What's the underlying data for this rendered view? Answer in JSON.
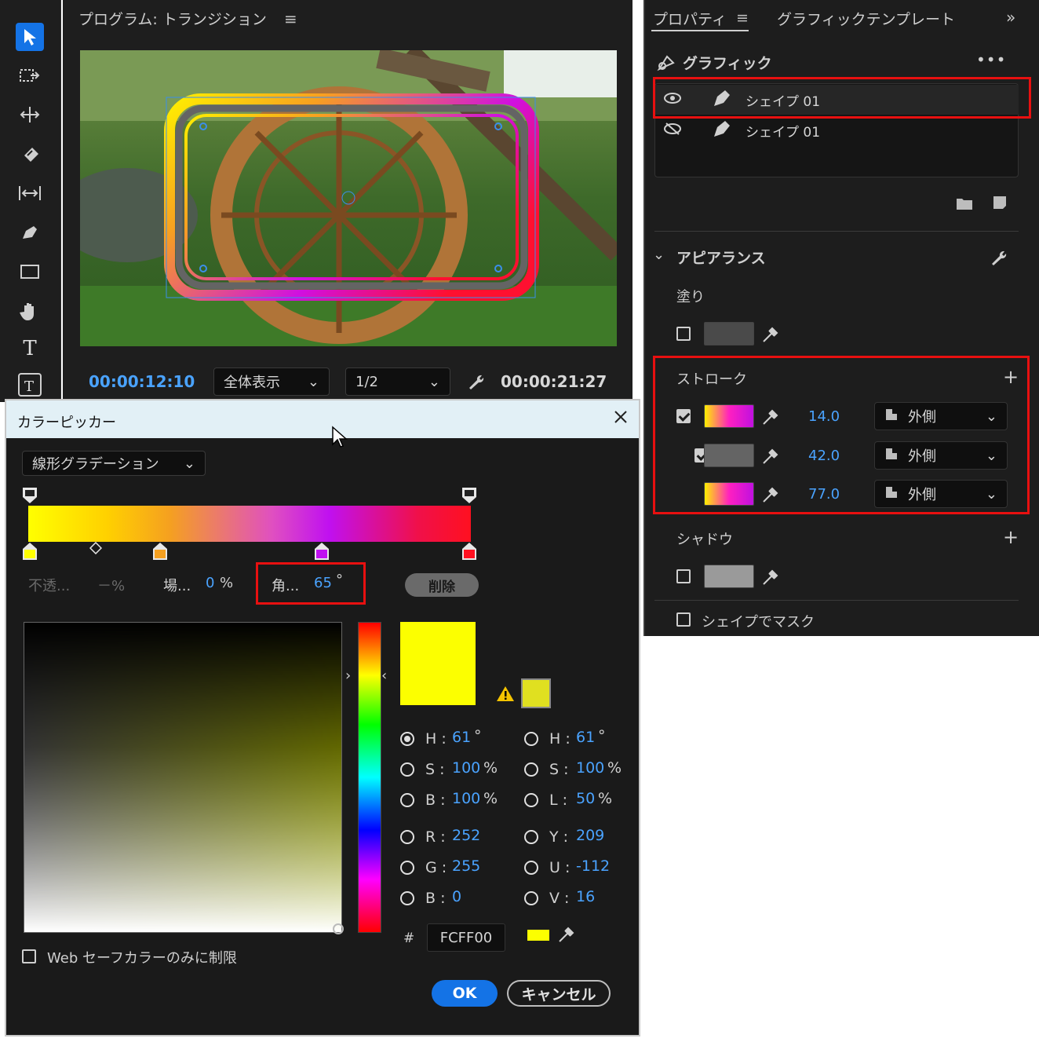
{
  "monitor": {
    "title": "プログラム: トランジション",
    "current_time": "00:00:12:10",
    "fit_select": "全体表示",
    "resolution_select": "1/2",
    "duration": "00:00:21:27"
  },
  "properties": {
    "tab_properties": "プロパティ",
    "tab_graphic_template": "グラフィックテンプレート",
    "graphic_header": "グラフィック",
    "layers": [
      {
        "name": "シェイプ 01",
        "visible": true
      },
      {
        "name": "シェイプ 01",
        "visible": false
      }
    ],
    "appearance": "アピアランス",
    "fill_label": "塗り",
    "stroke_label": "ストローク",
    "strokes": [
      {
        "width": "14.0",
        "position": "外側",
        "type": "gradient"
      },
      {
        "width": "42.0",
        "position": "外側",
        "type": "solid"
      },
      {
        "width": "77.0",
        "position": "外側",
        "type": "gradient"
      }
    ],
    "shadow_label": "シャドウ",
    "mask_label": "シェイプでマスク"
  },
  "color_picker": {
    "title": "カラーピッカー",
    "mode": "線形グラデーション",
    "opacity_label": "不透...",
    "opacity_value": "－%",
    "location_label": "場...",
    "location_value": "0",
    "location_unit": "%",
    "angle_label": "角...",
    "angle_value": "65",
    "angle_unit": "°",
    "delete_button": "削除",
    "hsb": {
      "h": "61",
      "s": "100",
      "b": "100"
    },
    "hsl": {
      "h": "61",
      "s": "100",
      "l": "50"
    },
    "rgb": {
      "r": "252",
      "g": "255",
      "b": "0"
    },
    "yuv": {
      "y": "209",
      "u": "-112",
      "v": "16"
    },
    "hex_label": "#",
    "hex": "FCFF00",
    "web_safe_label": "Web セーフカラーのみに制限",
    "ok": "OK",
    "cancel": "キャンセル",
    "labels": {
      "h": "H :",
      "s": "S :",
      "b": "B :",
      "l": "L :",
      "r": "R :",
      "g": "G :",
      "bb": "B :",
      "y": "Y :",
      "u": "U :",
      "v": "V :"
    },
    "units": {
      "deg": "°",
      "pct": "%"
    }
  },
  "colors": {
    "accent": "#1473e6",
    "value_blue": "#4aa3ff",
    "highlight_red": "#e81010",
    "selected_color": "#fcff00"
  }
}
